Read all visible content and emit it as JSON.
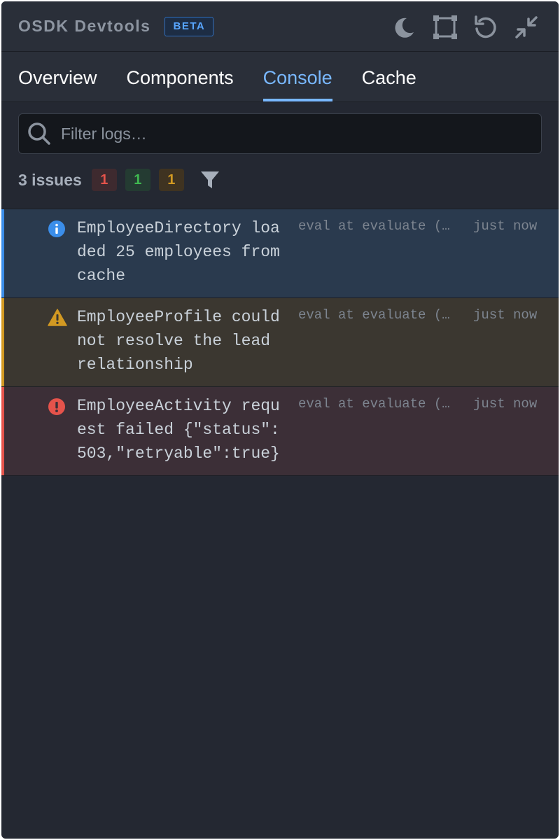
{
  "header": {
    "title": "OSDK Devtools",
    "badge": "BETA",
    "actions": [
      "moon-icon",
      "select-frame-icon",
      "refresh-icon",
      "minimize-icon"
    ]
  },
  "tabs": [
    {
      "label": "Overview",
      "active": false
    },
    {
      "label": "Components",
      "active": false
    },
    {
      "label": "Console",
      "active": true
    },
    {
      "label": "Cache",
      "active": false
    }
  ],
  "filter": {
    "placeholder": "Filter logs…",
    "issues_label": "3 issues",
    "counts": {
      "error": "1",
      "success": "1",
      "warning": "1"
    }
  },
  "logs": [
    {
      "level": "info",
      "message": "EmployeeDirectory loaded 25 employees from cache",
      "source": "eval at evaluate (…",
      "time": "just now"
    },
    {
      "level": "warning",
      "message": "EmployeeProfile could not resolve the lead relationship",
      "source": "eval at evaluate (…",
      "time": "just now"
    },
    {
      "level": "error",
      "message": "EmployeeActivity request failed {\"status\":503,\"retryable\":true}",
      "source": "eval at evaluate (…",
      "time": "just now"
    }
  ],
  "colors": {
    "info": "#3b8eea",
    "warning": "#d29922",
    "error": "#e5534b",
    "success": "#3fb950",
    "accent": "#79b8ff"
  }
}
